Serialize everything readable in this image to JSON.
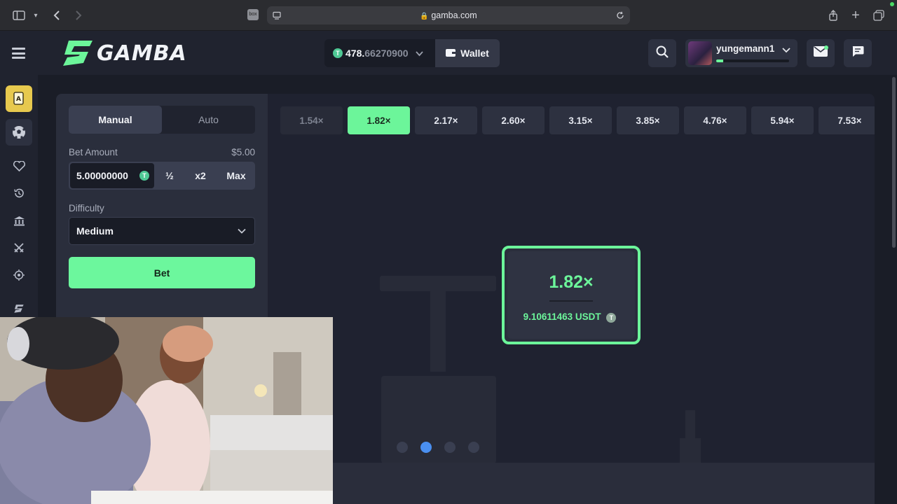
{
  "browser": {
    "url": "gamba.com",
    "favicon_label": "box"
  },
  "header": {
    "logo_text": "GAMBA",
    "balance_int": "478.",
    "balance_dec": "66270900",
    "wallet_label": "Wallet",
    "username": "yungemann1",
    "xp_progress": 0.1
  },
  "controls": {
    "tabs": [
      "Manual",
      "Auto"
    ],
    "active_tab": "Manual",
    "bet_amount_label": "Bet Amount",
    "bet_amount_usd": "$5.00",
    "bet_value": "5.00000000",
    "half_label": "½",
    "double_label": "x2",
    "max_label": "Max",
    "difficulty_label": "Difficulty",
    "difficulty_value": "Medium",
    "bet_button": "Bet"
  },
  "game": {
    "multipliers": [
      "1.54×",
      "1.82×",
      "2.17×",
      "2.60×",
      "3.15×",
      "3.85×",
      "4.76×",
      "5.94×",
      "7.53×"
    ],
    "active_multiplier_index": 1,
    "result_multiplier": "1.82×",
    "result_payout": "9.10611463 USDT",
    "step_dots": 4,
    "active_step": 1
  },
  "colors": {
    "accent": "#6cf59a",
    "header_bg": "#20232f",
    "panel_bg": "#2a2e3c",
    "game_bg": "#1f2230",
    "active_rail": "#e7c94e",
    "step_active": "#4a8ff0"
  },
  "icons": {
    "sidebar": [
      "sidebar-toggle-icon",
      "back-icon",
      "forward-icon"
    ],
    "rail": [
      "cards-icon",
      "soccer-ball-icon",
      "heart-icon",
      "history-icon",
      "casino-icon",
      "swords-icon",
      "target-icon",
      "logo-mark-icon"
    ]
  }
}
